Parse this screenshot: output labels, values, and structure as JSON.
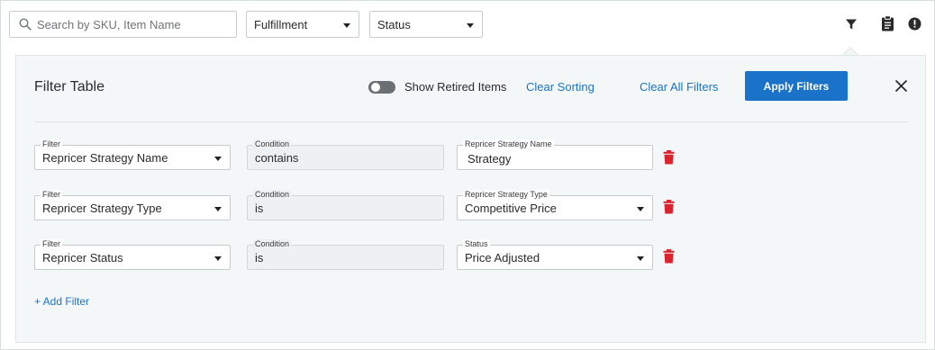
{
  "toolbar": {
    "search_placeholder": "Search by SKU, Item Name",
    "fulfillment_label": "Fulfillment",
    "status_label": "Status",
    "icons": [
      "filter-icon",
      "clipboard-icon",
      "info-icon"
    ]
  },
  "filter_panel": {
    "title": "Filter Table",
    "show_retired_label": "Show Retired Items",
    "show_retired_on": false,
    "clear_sorting": "Clear Sorting",
    "clear_all_filters": "Clear All Filters",
    "apply_filters": "Apply Filters",
    "add_filter": "+ Add Filter",
    "rows": [
      {
        "filter_label": "Filter",
        "filter_value": "Repricer Strategy Name",
        "condition_label": "Condition",
        "condition_value": "contains",
        "value_label": "Repricer Strategy Name",
        "value": "Strategy"
      },
      {
        "filter_label": "Filter",
        "filter_value": "Repricer Strategy Type",
        "condition_label": "Condition",
        "condition_value": "is",
        "value_label": "Repricer Strategy Type",
        "value": "Competitive Price"
      },
      {
        "filter_label": "Filter",
        "filter_value": "Repricer Status",
        "condition_label": "Condition",
        "condition_value": "is",
        "value_label": "Status",
        "value": "Price Adjusted"
      }
    ]
  },
  "colors": {
    "accent": "#1a73c8",
    "link": "#1d74c4",
    "delete": "#d9232e",
    "panel_bg": "#f4f7f8"
  }
}
